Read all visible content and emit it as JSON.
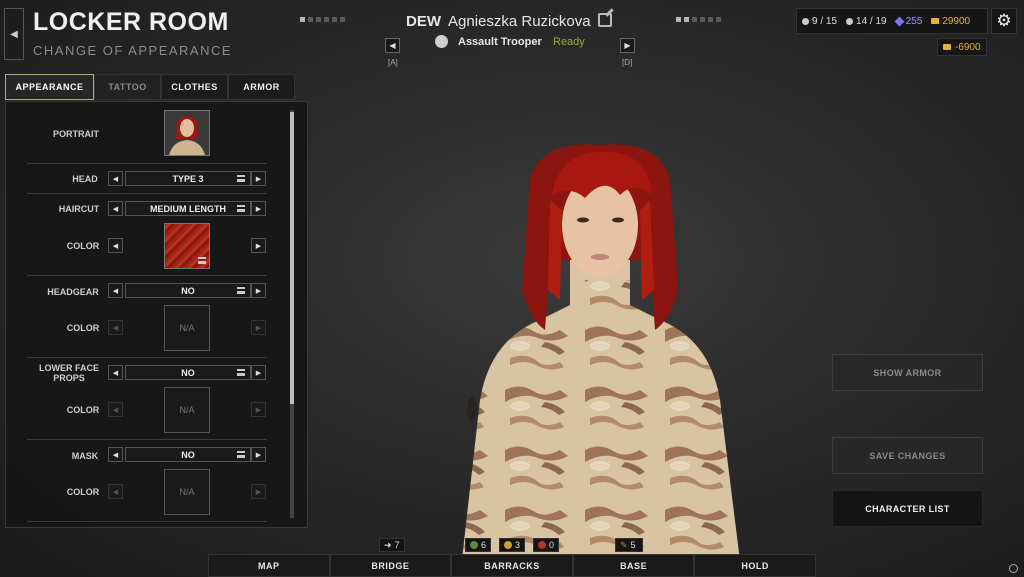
{
  "header": {
    "title": "LOCKER ROOM",
    "subtitle": "CHANGE OF APPEARANCE",
    "squad": "DEW",
    "character_name": "Agnieszka Ruzickova",
    "class_name": "Assault Trooper",
    "status": "Ready",
    "prev_key": "[A]",
    "next_key": "[D]"
  },
  "resources": {
    "soldiers": "9 / 15",
    "personnel": "14 / 19",
    "intel": "255",
    "credits": "29900",
    "cost": "-6900"
  },
  "tabs": [
    "APPEARANCE",
    "TATTOO",
    "CLOTHES",
    "ARMOR"
  ],
  "rows": {
    "portrait": "PORTRAIT",
    "head": {
      "label": "HEAD",
      "value": "TYPE 3"
    },
    "haircut": {
      "label": "HAIRCUT",
      "value": "MEDIUM LENGTH"
    },
    "hair_color": {
      "label": "COLOR"
    },
    "headgear": {
      "label": "HEADGEAR",
      "value": "NO"
    },
    "headgear_color": {
      "label": "COLOR",
      "value": "N/A"
    },
    "lower_face": {
      "label": "LOWER FACE PROPS",
      "value": "NO"
    },
    "lower_face_color": {
      "label": "COLOR",
      "value": "N/A"
    },
    "mask": {
      "label": "MASK",
      "value": "NO"
    },
    "mask_color": {
      "label": "COLOR",
      "value": "N/A"
    }
  },
  "side_buttons": {
    "show_armor": "SHOW ARMOR",
    "save_changes": "SAVE CHANGES",
    "character_list": "CHARACTER LIST"
  },
  "bottom_counters": {
    "arrivals": "7",
    "green": "6",
    "yellow": "3",
    "red": "0",
    "tools": "5"
  },
  "bottom_nav": [
    "MAP",
    "BRIDGE",
    "BARRACKS",
    "BASE",
    "HOLD"
  ],
  "colors": {
    "accent_gold": "#e2b52c",
    "ready_green": "#8bb03c",
    "intel_purple": "#7b73ff",
    "hair_red": "#b02a18"
  }
}
